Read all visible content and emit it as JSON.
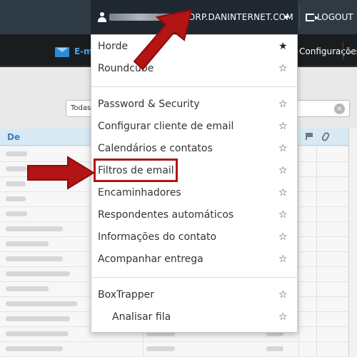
{
  "header": {
    "email_suffix": "@CORP.DANINTERNET.COM",
    "logout_label": "LOGOUT"
  },
  "toolbar": {
    "email_label": "E-mail",
    "config_label": "Configurações"
  },
  "search": {
    "scope_label": "Todas"
  },
  "message_list": {
    "column_from": "De",
    "row_count": 14
  },
  "dropdown": {
    "items": [
      {
        "label": "Horde",
        "starred": true
      },
      {
        "label": "Roundcube",
        "starred": false
      },
      {
        "label": "Password & Security",
        "starred": false
      },
      {
        "label": "Configurar cliente de email",
        "starred": false
      },
      {
        "label": "Calendários e contatos",
        "starred": false
      },
      {
        "label": "Filtros de email",
        "starred": false
      },
      {
        "label": "Encaminhadores",
        "starred": false
      },
      {
        "label": "Respondentes automáticos",
        "starred": false
      },
      {
        "label": "Informações do contato",
        "starred": false
      },
      {
        "label": "Acompanhar entrega",
        "starred": false
      },
      {
        "label": "BoxTrapper",
        "starred": false
      },
      {
        "label": "Analisar fila",
        "starred": false
      }
    ]
  },
  "colors": {
    "topbar": "#2e3a44",
    "accent_blue": "#2b8bd9",
    "annotation_red": "#b31414"
  }
}
